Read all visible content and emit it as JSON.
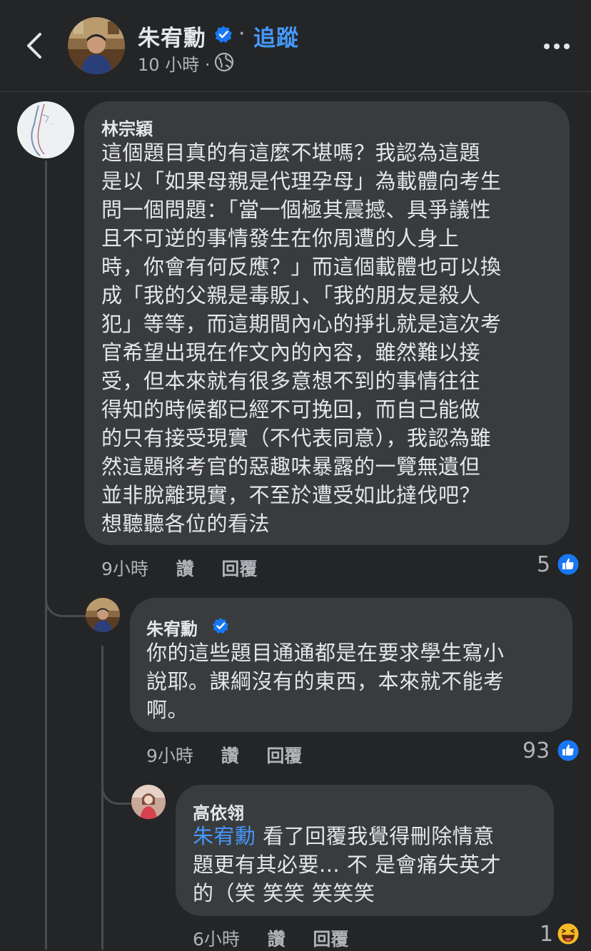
{
  "header": {
    "author": "朱宥勳",
    "separator": "·",
    "follow": "追蹤",
    "time": "10 小時",
    "time_sep": "·"
  },
  "comments": [
    {
      "author": "林宗穎",
      "text": "這個題目真的有這麼不堪嗎？我認為這題\n是以「如果母親是代理孕母」為載體向考生\n問一個問題：「當一個極其震撼、具爭議性\n且不可逆的事情發生在你周遭的人身上\n時，你會有何反應？」而這個載體也可以換\n成「我的父親是毒販」、「我的朋友是殺人\n犯」等等，而這期間內心的掙扎就是這次考\n官希望出現在作文內的內容，雖然難以接\n受，但本來就有很多意想不到的事情往往\n得知的時候都已經不可挽回，而自己能做\n的只有接受現實（不代表同意），我認為雖\n然這題將考官的惡趣味暴露的一覽無遺但\n並非脫離現實，不至於遭受如此撻伐吧？\n想聽聽各位的看法",
      "time": "9小時",
      "like": "讚",
      "reply": "回覆",
      "reactions": "5",
      "reaction_icon": "like-icon"
    },
    {
      "author": "朱宥勳",
      "text": "你的這些題目通通都是在要求學生寫小\n說耶。課綱沒有的東西，本來就不能考\n啊。",
      "time": "9小時",
      "like": "讚",
      "reply": "回覆",
      "reactions": "93",
      "reaction_icon": "like-icon"
    },
    {
      "author": "高依翎",
      "mention": "朱宥勳",
      "text_after_mention": " 看了回覆我覺得刪除情意",
      "text_rest": "題更有其必要... 不 是會痛失英才\n的（笑 笑笑 笑笑笑",
      "time": "6小時",
      "like": "讚",
      "reply": "回覆",
      "reactions": "1",
      "reaction_icon": "haha-icon"
    }
  ],
  "colors": {
    "background": "#242526",
    "bubble": "#3a3b3c",
    "accent": "#4599ff",
    "like_blue": "#1877f2",
    "haha_yellow": "#f7b928"
  }
}
